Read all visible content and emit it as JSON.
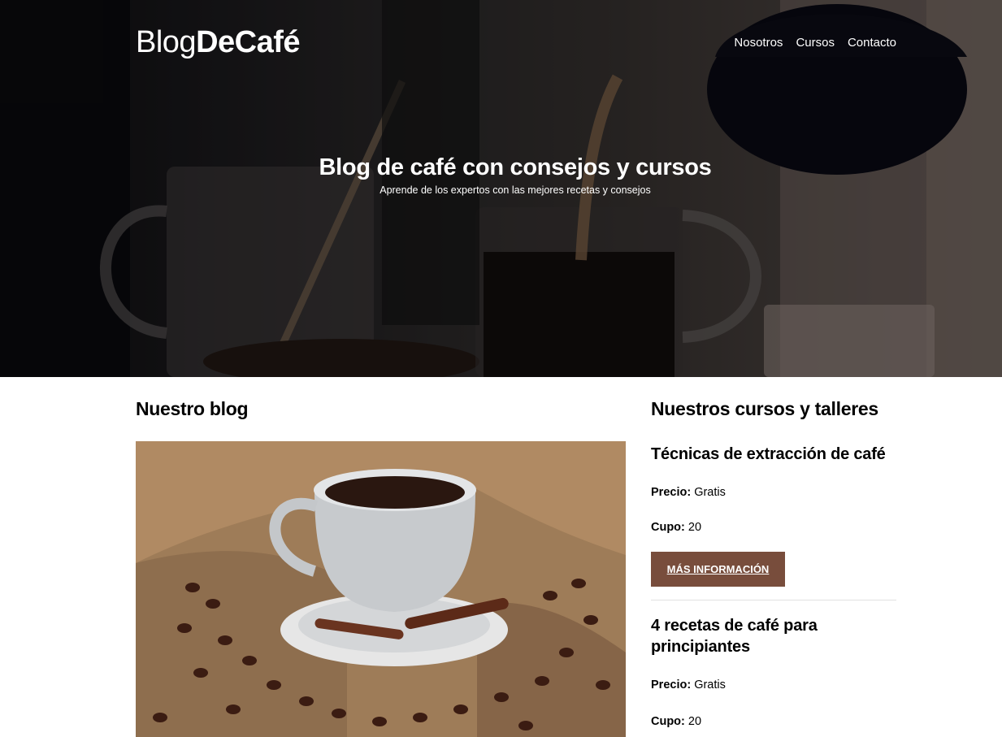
{
  "header": {
    "logo_light": "Blog",
    "logo_bold": "DeCafé",
    "nav": [
      "Nosotros",
      "Cursos",
      "Contacto"
    ]
  },
  "hero": {
    "title": "Blog de café con consejos y cursos",
    "subtitle": "Aprende de los expertos con las mejores recetas y consejos"
  },
  "blog": {
    "title": "Nuestro blog"
  },
  "courses": {
    "title": "Nuestros cursos y talleres",
    "items": [
      {
        "title": "Técnicas de extracción de café",
        "price_label": "Precio:",
        "price_value": "Gratis",
        "quota_label": "Cupo:",
        "quota_value": "20",
        "button": "Más Información"
      },
      {
        "title": "4 recetas de café para principiantes",
        "price_label": "Precio:",
        "price_value": "Gratis",
        "quota_label": "Cupo:",
        "quota_value": "20"
      }
    ]
  },
  "colors": {
    "button": "#784d3c",
    "hero_overlay": "#000000",
    "text": "#000000"
  }
}
